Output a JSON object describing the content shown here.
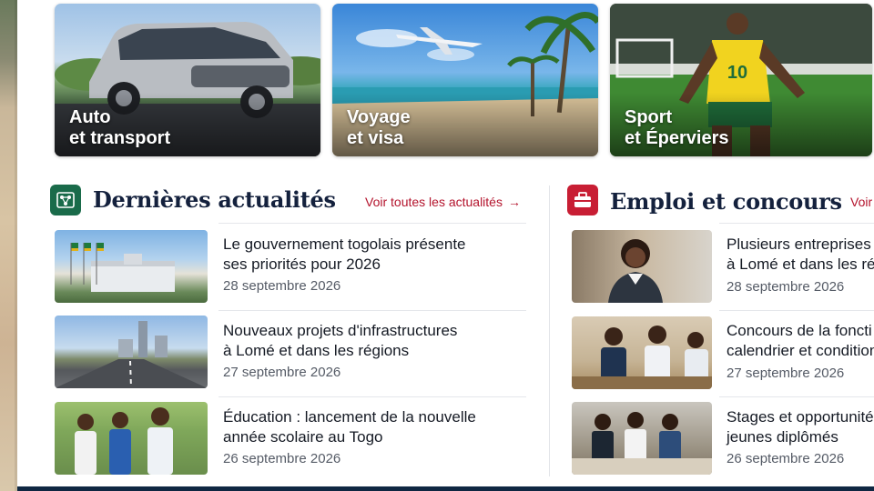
{
  "categories": [
    {
      "line1": "Auto",
      "line2": "et transport"
    },
    {
      "line1": "Voyage",
      "line2": "et visa"
    },
    {
      "line1": "Sport",
      "line2": "et Éperviers"
    }
  ],
  "news": {
    "title": "Dernières actualités",
    "see_all": "Voir toutes les actualités",
    "items": [
      {
        "line1": "Le gouvernement togolais présente",
        "line2": "ses priorités pour 2026",
        "date": "28 septembre 2026"
      },
      {
        "line1": "Nouveaux projets d'infrastructures",
        "line2": "à Lomé et dans les régions",
        "date": "27 septembre 2026"
      },
      {
        "line1": "Éducation : lancement de la nouvelle",
        "line2": "année scolaire au Togo",
        "date": "26 septembre 2026"
      }
    ]
  },
  "jobs": {
    "title": "Emploi et concours",
    "see_all": "Voir",
    "items": [
      {
        "line1": "Plusieurs entreprises",
        "line2": "à Lomé et dans les rég",
        "date": "28 septembre 2026"
      },
      {
        "line1": "Concours de la foncti",
        "line2": "calendrier et condition",
        "date": "27 septembre 2026"
      },
      {
        "line1": "Stages et opportunité",
        "line2": "jeunes diplômés",
        "date": "26 septembre 2026"
      }
    ]
  },
  "colors": {
    "news_icon_bg": "#1a6b4a",
    "jobs_icon_bg": "#c81e34",
    "accent_link": "#b4142d",
    "title_navy": "#14213d"
  },
  "icons": {
    "news": "network-icon",
    "jobs": "briefcase-icon",
    "see_all": "arrow-right-icon"
  }
}
